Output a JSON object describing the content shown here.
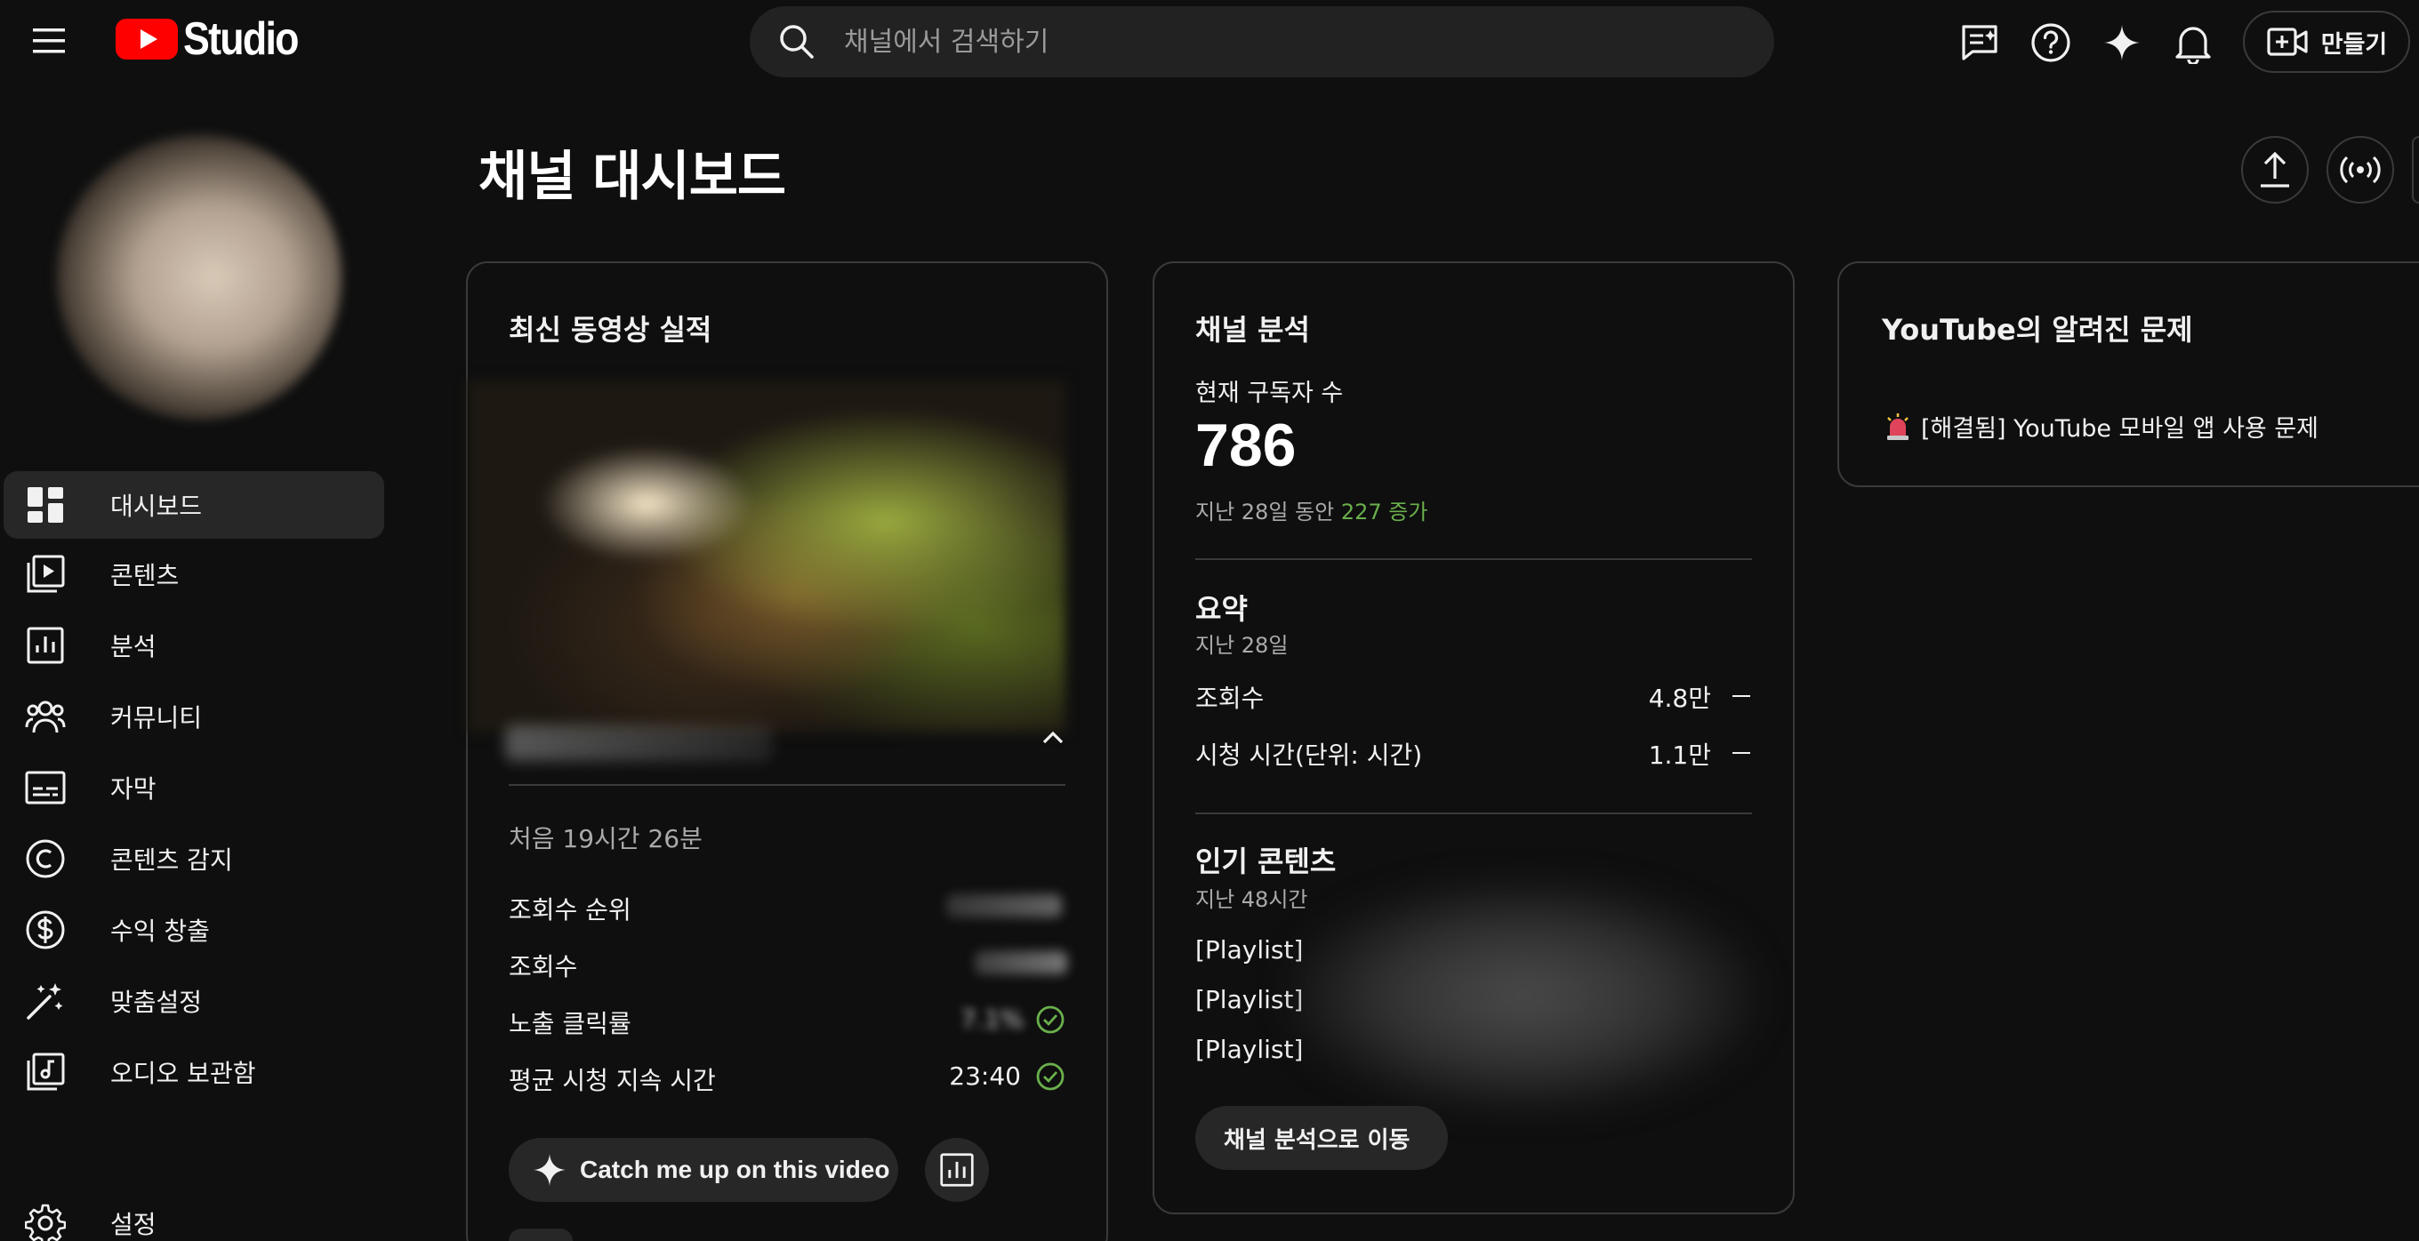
{
  "header": {
    "logo_text": "Studio",
    "search_placeholder": "채널에서 검색하기",
    "create_label": "만들기"
  },
  "sidebar": {
    "items": [
      {
        "label": "대시보드",
        "icon": "dashboard-icon",
        "active": true
      },
      {
        "label": "콘텐츠",
        "icon": "content-icon"
      },
      {
        "label": "분석",
        "icon": "analytics-icon"
      },
      {
        "label": "커뮤니티",
        "icon": "community-icon"
      },
      {
        "label": "자막",
        "icon": "subtitles-icon"
      },
      {
        "label": "콘텐츠 감지",
        "icon": "copyright-icon"
      },
      {
        "label": "수익 창출",
        "icon": "monetization-icon"
      },
      {
        "label": "맞춤설정",
        "icon": "customization-icon"
      },
      {
        "label": "오디오 보관함",
        "icon": "audio-library-icon"
      },
      {
        "label": "설정",
        "icon": "settings-icon"
      }
    ]
  },
  "page": {
    "title": "채널 대시보드"
  },
  "latest_video": {
    "title": "최신 동영상 실적",
    "first_period": "처음 19시간 26분",
    "rows": [
      {
        "label": "조회수 순위",
        "value": ""
      },
      {
        "label": "조회수",
        "value": ""
      },
      {
        "label": "노출 클릭률",
        "value": "7.1%"
      },
      {
        "label": "평균 시청 지속 시간",
        "value": "23:40"
      }
    ],
    "catch_up_label": "Catch me up on this video"
  },
  "analytics": {
    "title": "채널 분석",
    "subscribers_label": "현재 구독자 수",
    "subscribers_value": "786",
    "period_prefix": "지난 28일 동안",
    "period_change": "227 증가",
    "summary_title": "요약",
    "summary_period": "지난 28일",
    "summary_rows": [
      {
        "label": "조회수",
        "value": "4.8만"
      },
      {
        "label": "시청 시간(단위: 시간)",
        "value": "1.1만"
      }
    ],
    "popular_title": "인기 콘텐츠",
    "popular_period": "지난 48시간",
    "popular_items": [
      "[Playlist]",
      "[Playlist]",
      "[Playlist]"
    ],
    "goto_label": "채널 분석으로 이동"
  },
  "known_issues": {
    "title": "YouTube의 알려진 문제",
    "item": "[해결됨] YouTube 모바일 앱 사용 문제"
  },
  "colors": {
    "background": "#0f0f0f",
    "brand_red": "#ff0000",
    "positive_green": "#6ab04c",
    "card_border": "#3a3a3a",
    "active_item": "#272727"
  }
}
